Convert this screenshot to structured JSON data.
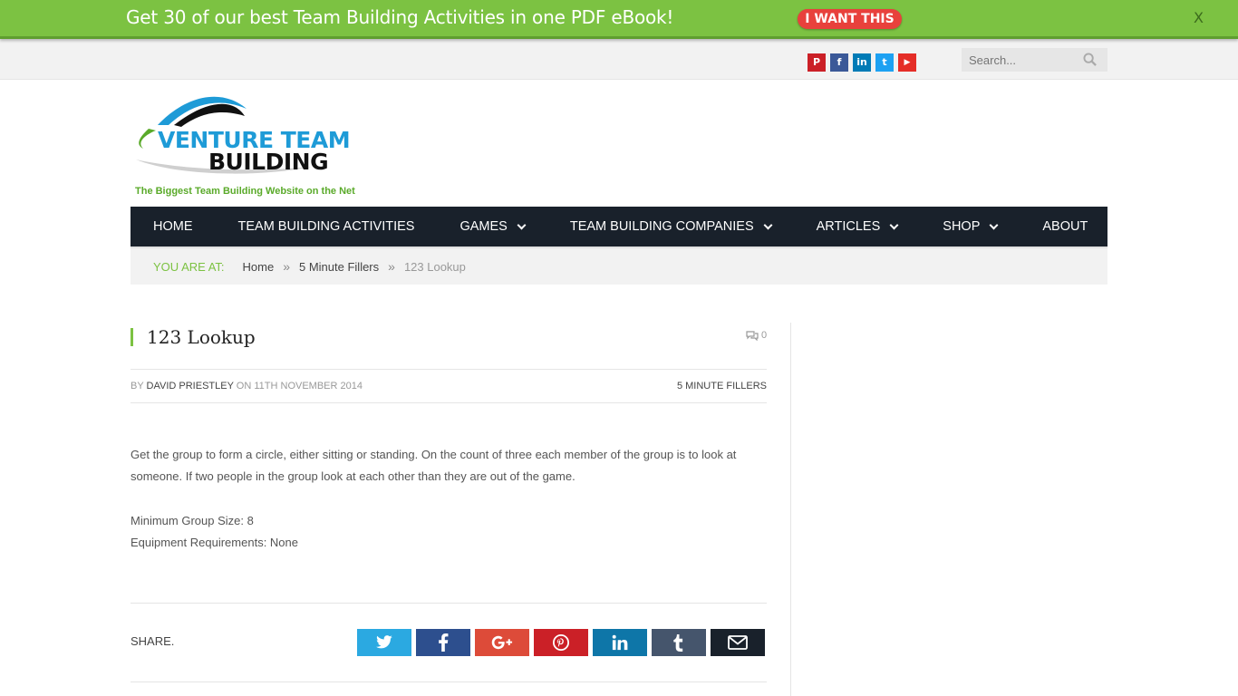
{
  "promo": {
    "text": "Get 30 of our best Team Building Activities in one PDF eBook!",
    "button": "I WANT THIS",
    "close": "X"
  },
  "topbar": {
    "social": [
      {
        "icon": "pinterest-icon",
        "glyph": "P",
        "color": "#cb2027"
      },
      {
        "icon": "facebook-icon",
        "glyph": "f",
        "color": "#3b5998"
      },
      {
        "icon": "linkedin-icon",
        "glyph": "in",
        "color": "#007bb6"
      },
      {
        "icon": "twitter-icon",
        "glyph": "t",
        "color": "#1da1f2"
      },
      {
        "icon": "youtube-icon",
        "glyph": "▶",
        "color": "#e52d27"
      }
    ],
    "search_placeholder": "Search..."
  },
  "logo": {
    "line1": "VENTURE TEAM",
    "line2": "BUILDING",
    "tagline": "The Biggest Team Building Website on the Net"
  },
  "nav": [
    {
      "label": "HOME",
      "dropdown": false
    },
    {
      "label": "TEAM BUILDING ACTIVITIES",
      "dropdown": false
    },
    {
      "label": "GAMES",
      "dropdown": true
    },
    {
      "label": "TEAM BUILDING COMPANIES",
      "dropdown": true
    },
    {
      "label": "ARTICLES",
      "dropdown": true
    },
    {
      "label": "SHOP",
      "dropdown": true
    },
    {
      "label": "ABOUT",
      "dropdown": false
    }
  ],
  "breadcrumb": {
    "prefix": "YOU ARE AT:",
    "items": [
      "Home",
      "5 Minute Fillers"
    ],
    "current": "123 Lookup",
    "separator": "»"
  },
  "article": {
    "title": "123 Lookup",
    "comment_count": "0",
    "by": "BY",
    "author": "DAVID PRIESTLEY",
    "on": "ON",
    "date": "11TH NOVEMBER 2014",
    "category": "5 MINUTE FILLERS",
    "paragraph": "Get the group to form a circle, either sitting or standing. On the count of three each member of the group is to look at someone. If two people in the group look at each other than they are out of the game.",
    "min_group": "Minimum Group Size: 8",
    "equipment": "Equipment Requirements: None"
  },
  "share": {
    "label": "SHARE.",
    "buttons": [
      {
        "icon": "twitter-icon",
        "color": "#2ba9e1"
      },
      {
        "icon": "facebook-icon",
        "color": "#2d4f8e"
      },
      {
        "icon": "google-plus-icon",
        "color": "#dd4b39"
      },
      {
        "icon": "pinterest-icon",
        "color": "#cb2027"
      },
      {
        "icon": "linkedin-icon",
        "color": "#0e76a8"
      },
      {
        "icon": "tumblr-icon",
        "color": "#45556c"
      },
      {
        "icon": "email-icon",
        "color": "#19212b"
      }
    ]
  }
}
